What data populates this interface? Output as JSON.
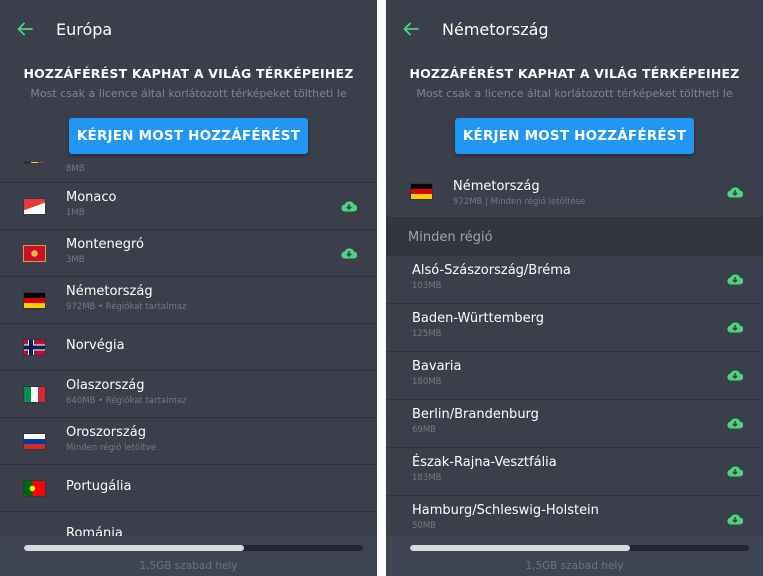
{
  "colors": {
    "accent_green": "#4cd47e",
    "cta_blue": "#2196f3",
    "background": "#3a3f4b"
  },
  "left": {
    "title": "Európa",
    "promo": {
      "title": "HOZZÁFÉRÉST KAPHAT A VILÁG TÉRKÉPEIHEZ",
      "subtitle": "Most csak a licence által korlátozott térképeket töltheti le",
      "button": "KÉRJEN MOST HOZZÁFÉRÉST"
    },
    "items": [
      {
        "name": "",
        "meta": "8MB"
      },
      {
        "name": "Monaco",
        "meta": "1MB"
      },
      {
        "name": "Montenegró",
        "meta": "3MB"
      },
      {
        "name": "Németország",
        "meta": "972MB • Régiókat tartalmaz"
      },
      {
        "name": "Norvégia",
        "meta": ""
      },
      {
        "name": "Olaszország",
        "meta": "640MB • Régiókat tartalmaz"
      },
      {
        "name": "Oroszország",
        "meta": "Minden régió letöltve"
      },
      {
        "name": "Portugália",
        "meta": ""
      },
      {
        "name": "Románia",
        "meta": ""
      }
    ],
    "storage": {
      "text": "1,5GB szabad hely",
      "used_fraction": 0.65
    }
  },
  "right": {
    "title": "Németország",
    "promo": {
      "title": "HOZZÁFÉRÉST KAPHAT A VILÁG TÉRKÉPEIHEZ",
      "subtitle": "Most csak a licence által korlátozott térképeket töltheti le",
      "button": "KÉRJEN MOST HOZZÁFÉRÉST"
    },
    "country": {
      "name": "Németország",
      "meta": "972MB | Minden régió letöltése"
    },
    "section": "Minden régió",
    "items": [
      {
        "name": "Alsó-Szászország/Bréma",
        "meta": "103MB"
      },
      {
        "name": "Baden-Württemberg",
        "meta": "125MB"
      },
      {
        "name": "Bavaria",
        "meta": "180MB"
      },
      {
        "name": "Berlin/Brandenburg",
        "meta": "69MB"
      },
      {
        "name": "Észak-Rajna-Vesztfália",
        "meta": "183MB"
      },
      {
        "name": "Hamburg/Schleswig-Holstein",
        "meta": "50MB"
      }
    ],
    "storage": {
      "text": "1,5GB szabad hely",
      "used_fraction": 0.65
    }
  }
}
